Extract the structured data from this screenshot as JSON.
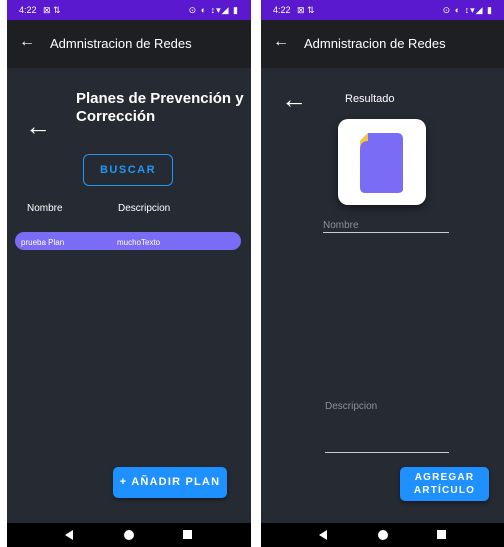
{
  "status_bar": {
    "time": "4:22",
    "left_icons": "⊠ ⇅",
    "right_icons": "⊙ ◐ ↕▾◢ ▮"
  },
  "app_bar": {
    "title": "Admnistracion de Redes",
    "back_glyph": "←"
  },
  "left_screen": {
    "back_glyph": "←",
    "title": "Planes de Prevención y Corrección",
    "search_button": "BUSCAR",
    "columns": [
      "Nombre",
      "Descripcion"
    ],
    "rows": [
      {
        "name": "prueba Plan",
        "description": "muchoTexto"
      }
    ],
    "add_button": "+ AÑADIR PLAN"
  },
  "right_screen": {
    "back_glyph": "←",
    "header": "Resultado",
    "fields": {
      "name_placeholder": "Nombre",
      "description_placeholder": "Descripcion"
    },
    "add_article_button": "AGREGAR ARTÍCULO"
  },
  "icons": {
    "document": "document-icon"
  },
  "colors": {
    "status_bar": "#5a18cf",
    "app_bar": "#1d1f22",
    "background": "#262b33",
    "accent": "#2196f3",
    "row": "#7b6cf6",
    "document_body": "#7b6cf6",
    "document_fold": "#f4c542"
  }
}
